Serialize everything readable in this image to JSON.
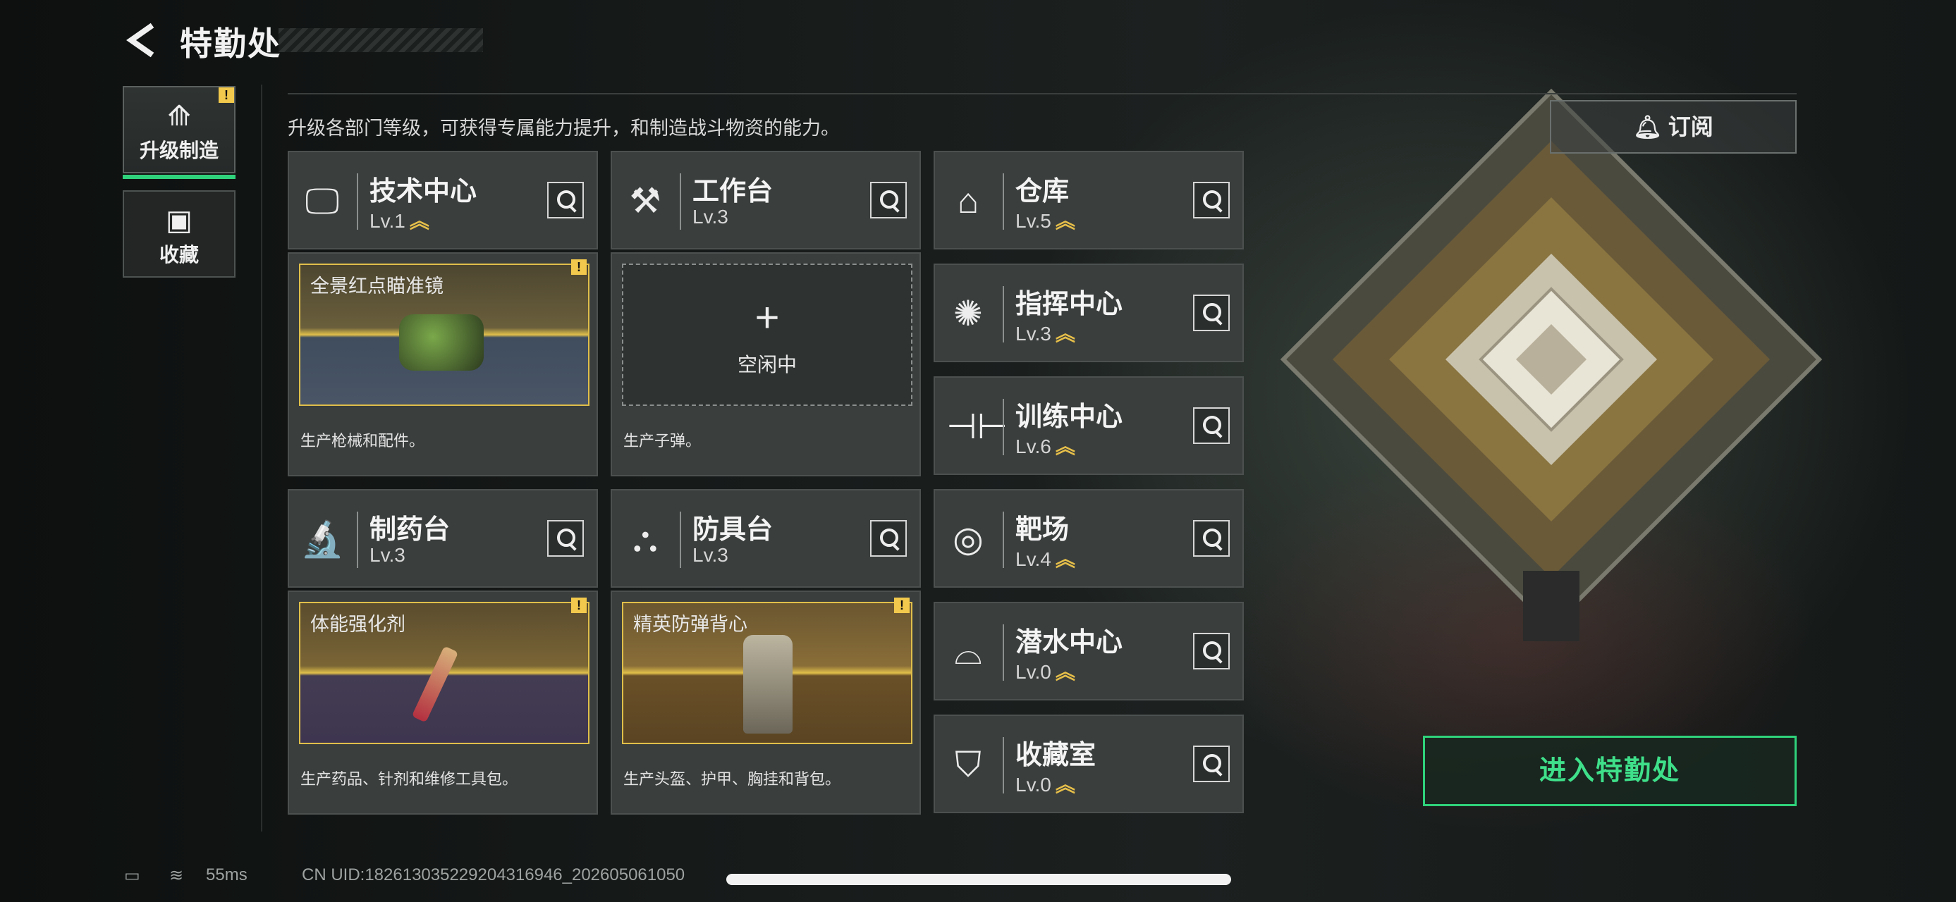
{
  "header": {
    "title": "特勤处"
  },
  "tabs": [
    {
      "label": "升级制造",
      "icon": "upgrade-icon",
      "active": true,
      "alert": "!"
    },
    {
      "label": "收藏",
      "icon": "collection-icon",
      "active": false
    }
  ],
  "subtitle": "升级各部门等级，可获得专属能力提升，和制造战斗物资的能力。",
  "subscribe_label": "订阅",
  "enter_label": "进入特勤处",
  "facilities": {
    "tech": {
      "name": "技术中心",
      "level": "Lv.1"
    },
    "workbench": {
      "name": "工作台",
      "level": "Lv.3"
    },
    "warehouse": {
      "name": "仓库",
      "level": "Lv.5"
    },
    "command": {
      "name": "指挥中心",
      "level": "Lv.3"
    },
    "training": {
      "name": "训练中心",
      "level": "Lv.6"
    },
    "pharmacy": {
      "name": "制药台",
      "level": "Lv.3"
    },
    "armor": {
      "name": "防具台",
      "level": "Lv.3"
    },
    "range": {
      "name": "靶场",
      "level": "Lv.4"
    },
    "diving": {
      "name": "潜水中心",
      "level": "Lv.0"
    },
    "vault": {
      "name": "收藏室",
      "level": "Lv.0"
    }
  },
  "production": {
    "tech": {
      "item": "全景红点瞄准镜",
      "desc": "生产枪械和配件。",
      "alert": "!"
    },
    "workbench": {
      "idle": "空闲中",
      "plus": "+",
      "desc": "生产子弹。"
    },
    "pharmacy": {
      "item": "体能强化剂",
      "desc": "生产药品、针剂和维修工具包。",
      "alert": "!"
    },
    "armor": {
      "item": "精英防弹背心",
      "desc": "生产头盔、护甲、胸挂和背包。",
      "alert": "!"
    }
  },
  "status_bar": {
    "ping": "55ms",
    "uid": "CN UID:1826130352292043169​46_202605061050"
  },
  "colors": {
    "accent": "#2fd27a",
    "gold": "#e0bf4a",
    "warn": "#f2c94c"
  }
}
